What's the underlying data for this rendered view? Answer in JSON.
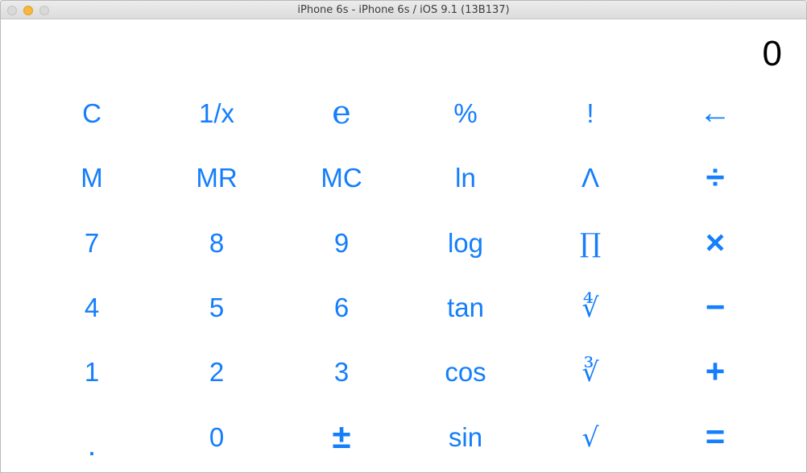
{
  "window": {
    "title": "iPhone 6s - iPhone 6s / iOS 9.1 (13B137)"
  },
  "display": {
    "value": "0"
  },
  "keys": {
    "r1": [
      "C",
      "1/x",
      "e",
      "%",
      "!",
      "←"
    ],
    "r2": [
      "M",
      "MR",
      "MC",
      "ln",
      "Λ",
      "÷"
    ],
    "r3": [
      "7",
      "8",
      "9",
      "log",
      "∏",
      "×"
    ],
    "r4": [
      "4",
      "5",
      "6",
      "tan",
      "∜",
      "−"
    ],
    "r5": [
      "1",
      "2",
      "3",
      "cos",
      "∛",
      "+"
    ],
    "r6": [
      ".",
      "0",
      "±",
      "sin",
      "√",
      "="
    ]
  },
  "colors": {
    "accent": "#147efb",
    "display_text": "#000000",
    "background": "#ffffff"
  }
}
